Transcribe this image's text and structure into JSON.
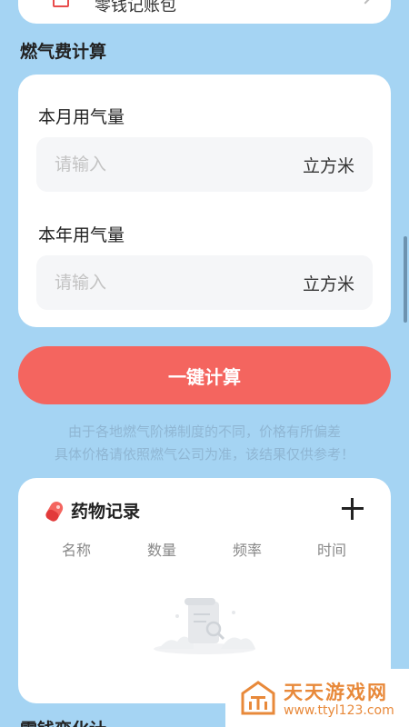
{
  "top_card": {
    "label": "零钱记账包"
  },
  "gas_section": {
    "title": "燃气费计算",
    "monthly": {
      "label": "本月用气量",
      "placeholder": "请输入",
      "unit": "立方米"
    },
    "yearly": {
      "label": "本年用气量",
      "placeholder": "请输入",
      "unit": "立方米"
    }
  },
  "calc_button": {
    "label": "一键计算"
  },
  "notice": {
    "line1": "由于各地燃气阶梯制度的不同，价格有所偏差",
    "line2": "具体价格请依照燃气公司为准，该结果仅供参考！"
  },
  "medicine_section": {
    "title": "药物记录",
    "columns": [
      "名称",
      "数量",
      "频率",
      "时间"
    ]
  },
  "bottom_section": {
    "title": "零钱变化计"
  },
  "watermark": {
    "name": "天天游戏网",
    "url": "www.ttyl123.com"
  },
  "colors": {
    "background": "#a5d4f3",
    "primary_button": "#f4655f",
    "notice_text": "#8fb6d3",
    "watermark": "#e8893a"
  },
  "icons": {
    "wallet": "wallet-icon",
    "chevron": "chevron-right-icon",
    "pill": "pill-icon",
    "add": "plus-icon",
    "empty": "empty-state-illustration"
  }
}
